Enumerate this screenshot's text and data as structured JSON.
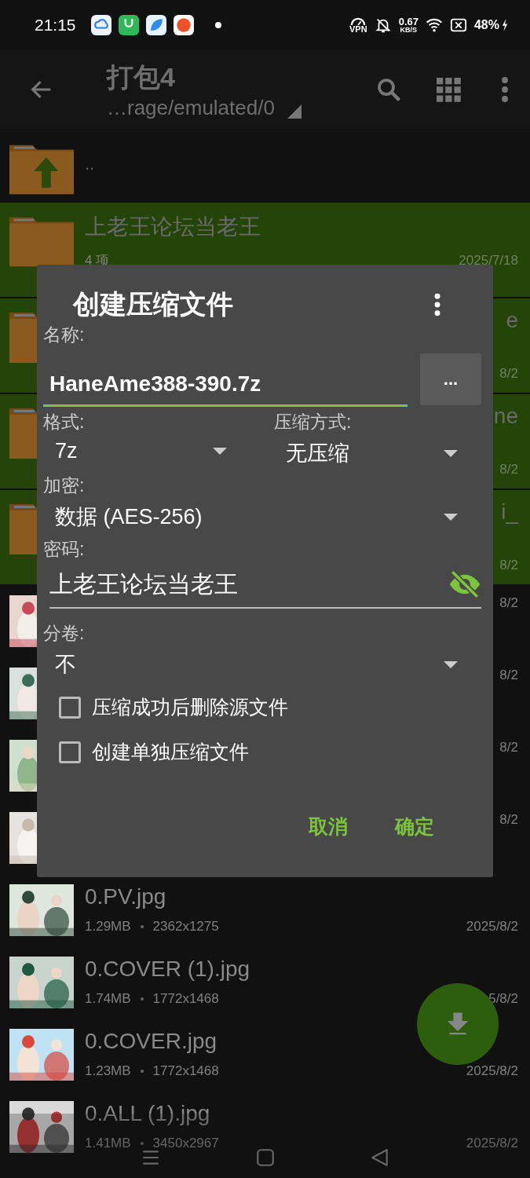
{
  "status_bar": {
    "time": "21:15",
    "vpn_label": "VPN",
    "net_speed": "0.67",
    "net_unit": "KB/S",
    "battery": "48%"
  },
  "app_bar": {
    "title": "打包4",
    "path": "…rage/emulated/0"
  },
  "file_list": [
    {
      "kind": "parent",
      "name": ".."
    },
    {
      "kind": "folder",
      "selected": true,
      "name": "上老王论坛当老王",
      "meta": "4 项",
      "date": "2025/7/18"
    },
    {
      "kind": "folder",
      "selected": true,
      "name": "e",
      "date": "8/2"
    },
    {
      "kind": "folder",
      "selected": true,
      "name": "ne",
      "date": "8/2"
    },
    {
      "kind": "folder",
      "selected": true,
      "name": "i_",
      "date": "8/2"
    },
    {
      "selected": false,
      "date": "8/2"
    },
    {
      "selected": false,
      "date": "8/2"
    },
    {
      "selected": false,
      "date": "8/2"
    },
    {
      "selected": false,
      "date": "8/2"
    },
    {
      "selected": false,
      "name": "0.PV.jpg",
      "size": "1.29MB",
      "dimensions": "2362x1275",
      "date": "2025/8/2"
    },
    {
      "selected": false,
      "name": "0.COVER (1).jpg",
      "size": "1.74MB",
      "dimensions": "1772x1468",
      "date": "5/8/2"
    },
    {
      "selected": false,
      "name": "0.COVER.jpg",
      "size": "1.23MB",
      "dimensions": "1772x1468",
      "date": "2025/8/2"
    },
    {
      "selected": false,
      "name": "0.ALL (1).jpg",
      "size": "1.41MB",
      "dimensions": "3450x2967",
      "date": "2025/8/2"
    }
  ],
  "dialog": {
    "title": "创建压缩文件",
    "name_label": "名称:",
    "name_value": "HaneAme388-390.7z",
    "browse_button": "...",
    "format_label": "格式:",
    "format_value": "7z",
    "method_label": "压缩方式:",
    "method_value": "无压缩",
    "encryption_label": "加密:",
    "encryption_value": "数据 (AES-256)",
    "password_label": "密码:",
    "password_value": "上老王论坛当老王",
    "split_label": "分卷:",
    "split_value": "不",
    "options": [
      {
        "label": "压缩成功后删除源文件",
        "checked": false
      },
      {
        "label": "创建单独压缩文件",
        "checked": false
      }
    ],
    "buttons": [
      "取消",
      "确定"
    ]
  }
}
